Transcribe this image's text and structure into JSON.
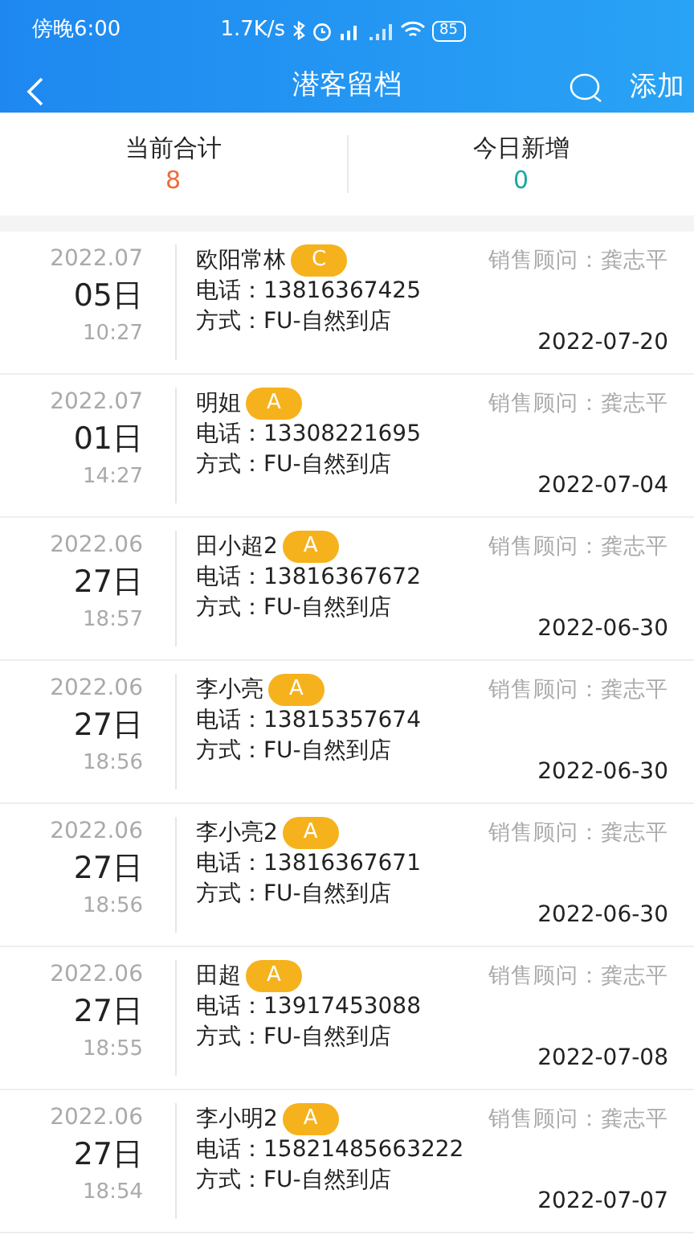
{
  "status_bar": {
    "time": "傍晚6:00",
    "speed": "1.7K/s",
    "battery": "85"
  },
  "nav": {
    "title": "潜客留档",
    "action": "添加"
  },
  "summary": [
    {
      "label": "当前合计",
      "value": "8",
      "kind": "total"
    },
    {
      "label": "今日新增",
      "value": "0",
      "kind": "new"
    }
  ],
  "customers": [
    {
      "month": "2022.07",
      "day": "05日",
      "time": "10:27",
      "name": "欧阳常林",
      "grade": "C",
      "phone_label": "电话：",
      "phone": "13816367425",
      "method": "方式：FU-自然到店",
      "consultant": "销售顾问：龚志平",
      "date": "2022-07-20"
    },
    {
      "month": "2022.07",
      "day": "01日",
      "time": "14:27",
      "name": "明姐",
      "grade": "A",
      "phone_label": "电话：",
      "phone": "13308221695",
      "method": "方式：FU-自然到店",
      "consultant": "销售顾问：龚志平",
      "date": "2022-07-04"
    },
    {
      "month": "2022.06",
      "day": "27日",
      "time": "18:57",
      "name": "田小超2",
      "grade": "A",
      "phone_label": "电话：",
      "phone": "13816367672",
      "method": "方式：FU-自然到店",
      "consultant": "销售顾问：龚志平",
      "date": "2022-06-30"
    },
    {
      "month": "2022.06",
      "day": "27日",
      "time": "18:56",
      "name": "李小亮",
      "grade": "A",
      "phone_label": "电话：",
      "phone": "13815357674",
      "method": "方式：FU-自然到店",
      "consultant": "销售顾问：龚志平",
      "date": "2022-06-30"
    },
    {
      "month": "2022.06",
      "day": "27日",
      "time": "18:56",
      "name": "李小亮2",
      "grade": "A",
      "phone_label": "电话：",
      "phone": "13816367671",
      "method": "方式：FU-自然到店",
      "consultant": "销售顾问：龚志平",
      "date": "2022-06-30"
    },
    {
      "month": "2022.06",
      "day": "27日",
      "time": "18:55",
      "name": "田超",
      "grade": "A",
      "phone_label": "电话：",
      "phone": "13917453088",
      "method": "方式：FU-自然到店",
      "consultant": "销售顾问：龚志平",
      "date": "2022-07-08"
    },
    {
      "month": "2022.06",
      "day": "27日",
      "time": "18:54",
      "name": "李小明2",
      "grade": "A",
      "phone_label": "电话：",
      "phone": "15821485663222",
      "method": "方式：FU-自然到店",
      "consultant": "销售顾问：龚志平",
      "date": "2022-07-07"
    }
  ]
}
